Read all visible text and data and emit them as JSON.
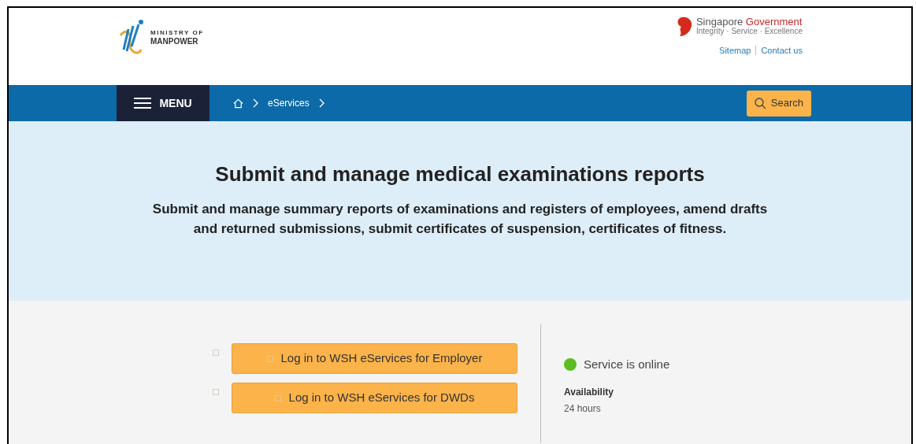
{
  "header": {
    "logo_line1": "MINISTRY OF",
    "logo_line2": "MANPOWER",
    "gov_name_1": "Singapore",
    "gov_name_2": "Government",
    "gov_motto": "Integrity · Service · Excellence",
    "links": [
      "Sitemap",
      "Contact us"
    ]
  },
  "nav": {
    "menu": "MENU",
    "breadcrumb": [
      "eServices"
    ],
    "search": "Search"
  },
  "hero": {
    "title": "Submit and manage medical examinations reports",
    "subtitle": "Submit and manage summary reports of examinations and registers of employees, amend drafts and returned submissions, submit certificates of suspension, certificates of fitness."
  },
  "actions": [
    "Log in to WSH eServices for Employer",
    "Log in to WSH eServices for DWDs"
  ],
  "status": {
    "text": "Service is online",
    "color": "#5bbd23"
  },
  "availability": {
    "label": "Availability",
    "value": "24 hours"
  }
}
